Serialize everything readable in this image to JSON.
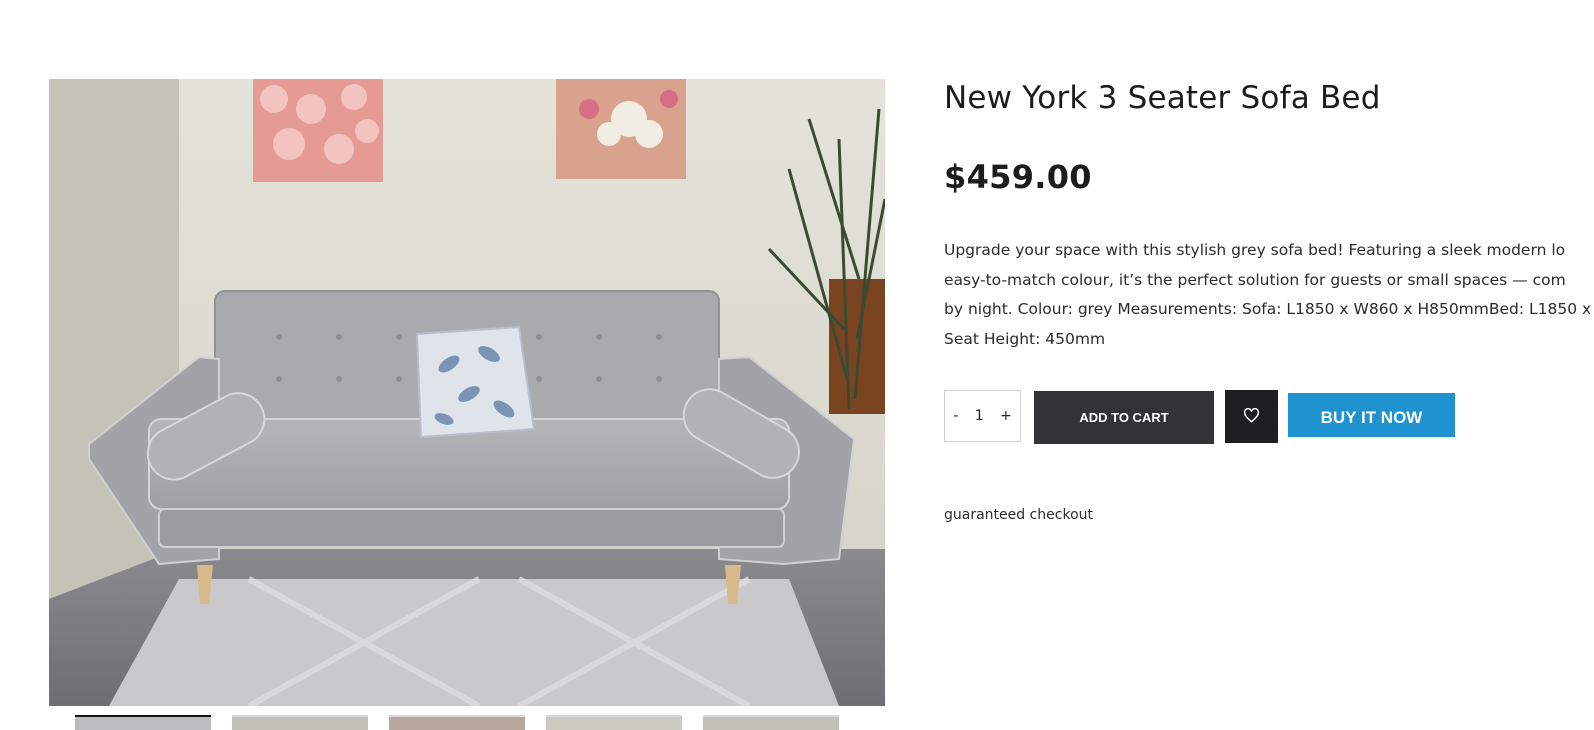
{
  "product": {
    "title": "New York 3 Seater Sofa Bed",
    "price": "$459.00",
    "description_lines": [
      "Upgrade your space with this stylish grey sofa bed! Featuring a sleek modern lo",
      "easy-to-match colour, it’s the perfect solution for guests or small spaces — com",
      "by night. Colour: grey Measurements:  Sofa: L1850 x W860 x H850mmBed: L1850 x",
      "Seat Height: 450mm"
    ],
    "image": {
      "icon": "sofa-photo",
      "thumbnail_count": 5
    }
  },
  "purchase": {
    "quantity": "1",
    "decrement_label": "-",
    "increment_label": "+",
    "add_to_cart_label": "ADD TO CART",
    "wishlist_icon": "heart-icon",
    "buy_now_label": "BUY IT NOW"
  },
  "trust": {
    "guarantee_text": "guaranteed checkout"
  },
  "colors": {
    "add_to_cart_bg": "#323337",
    "wishlist_bg": "#1f1f21",
    "buy_now_bg": "#1e93d0",
    "sofa": "#a9abae"
  }
}
